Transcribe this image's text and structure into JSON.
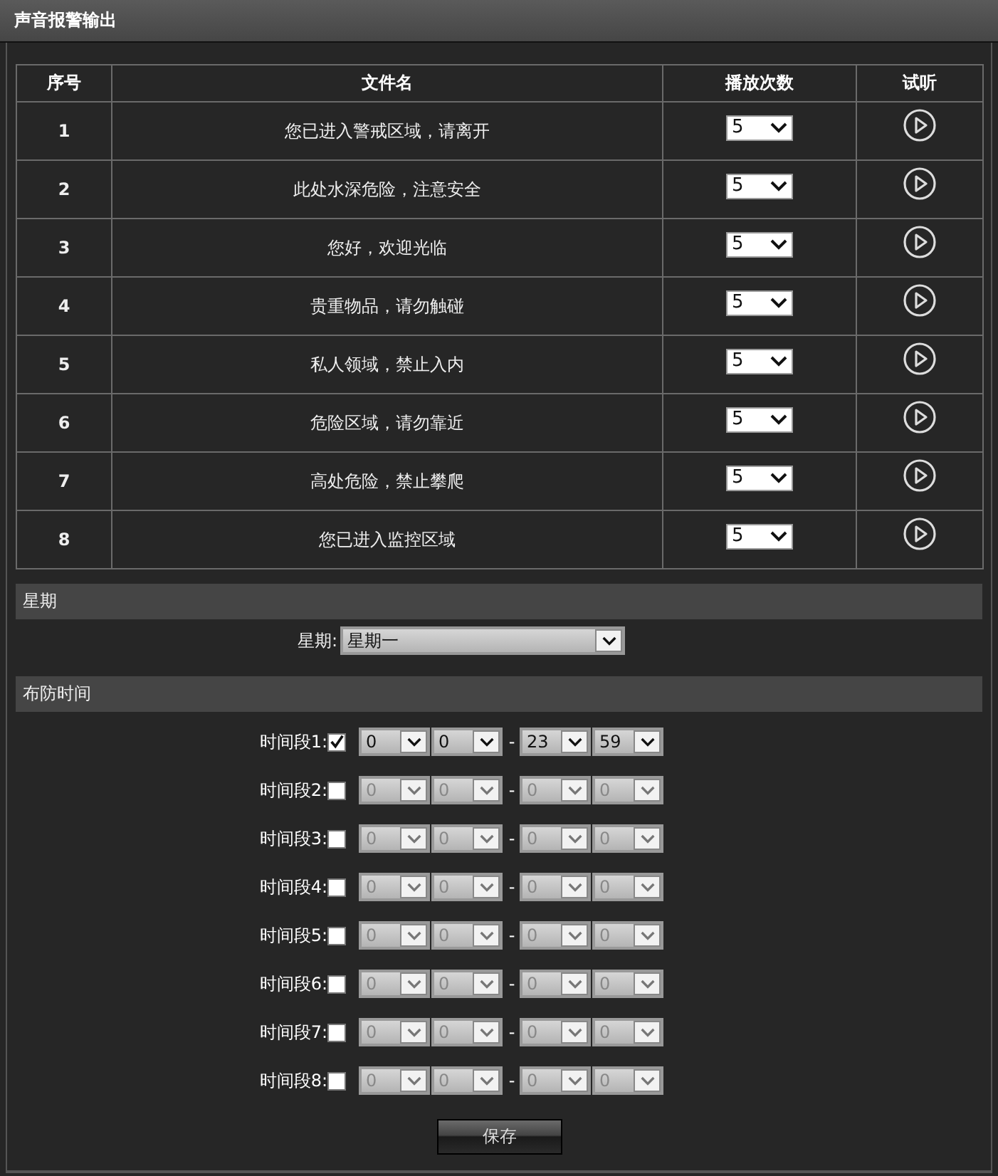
{
  "window": {
    "title": "声音报警输出"
  },
  "table": {
    "columns": [
      "序号",
      "文件名",
      "播放次数",
      "试听"
    ],
    "rows": [
      {
        "index": "1",
        "file": "您已进入警戒区域，请离开",
        "count": "5"
      },
      {
        "index": "2",
        "file": "此处水深危险，注意安全",
        "count": "5"
      },
      {
        "index": "3",
        "file": "您好，欢迎光临",
        "count": "5"
      },
      {
        "index": "4",
        "file": "贵重物品，请勿触碰",
        "count": "5"
      },
      {
        "index": "5",
        "file": "私人领域，禁止入内",
        "count": "5"
      },
      {
        "index": "6",
        "file": "危险区域，请勿靠近",
        "count": "5"
      },
      {
        "index": "7",
        "file": "高处危险，禁止攀爬",
        "count": "5"
      },
      {
        "index": "8",
        "file": "您已进入监控区域",
        "count": "5"
      }
    ]
  },
  "week_section": {
    "title": "星期",
    "label": "星期:",
    "value": "星期一"
  },
  "schedule_section": {
    "title": "布防时间",
    "separator": "-",
    "periods": [
      {
        "label": "时间段1:",
        "checked": true,
        "start_hour": "0",
        "start_minute": "0",
        "end_hour": "23",
        "end_minute": "59"
      },
      {
        "label": "时间段2:",
        "checked": false,
        "start_hour": "0",
        "start_minute": "0",
        "end_hour": "0",
        "end_minute": "0"
      },
      {
        "label": "时间段3:",
        "checked": false,
        "start_hour": "0",
        "start_minute": "0",
        "end_hour": "0",
        "end_minute": "0"
      },
      {
        "label": "时间段4:",
        "checked": false,
        "start_hour": "0",
        "start_minute": "0",
        "end_hour": "0",
        "end_minute": "0"
      },
      {
        "label": "时间段5:",
        "checked": false,
        "start_hour": "0",
        "start_minute": "0",
        "end_hour": "0",
        "end_minute": "0"
      },
      {
        "label": "时间段6:",
        "checked": false,
        "start_hour": "0",
        "start_minute": "0",
        "end_hour": "0",
        "end_minute": "0"
      },
      {
        "label": "时间段7:",
        "checked": false,
        "start_hour": "0",
        "start_minute": "0",
        "end_hour": "0",
        "end_minute": "0"
      },
      {
        "label": "时间段8:",
        "checked": false,
        "start_hour": "0",
        "start_minute": "0",
        "end_hour": "0",
        "end_minute": "0"
      }
    ]
  },
  "save_button": "保存"
}
